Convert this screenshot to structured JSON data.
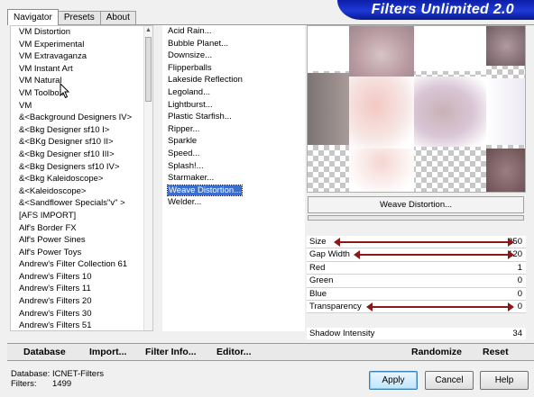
{
  "tabs": [
    "Navigator",
    "Presets",
    "About"
  ],
  "banner_title": "Filters Unlimited 2.0",
  "categories": [
    "VM Distortion",
    "VM Experimental",
    "VM Extravaganza",
    "VM Instant Art",
    "VM Natural",
    "VM Toolbox",
    "VM",
    "&<Background Designers IV>",
    "&<Bkg Designer sf10 I>",
    "&<BKg Designer sf10 II>",
    "&<Bkg Designer sf10 III>",
    "&<Bkg Designers sf10 IV>",
    "&<Bkg Kaleidoscope>",
    "&<Kaleidoscope>",
    "&<Sandflower Specials\"v\" >",
    "[AFS IMPORT]",
    "Alf's Border FX",
    "Alf's Power Sines",
    "Alf's Power Toys",
    "Andrew's Filter Collection 61",
    "Andrew's Filters 10",
    "Andrew's Filters 11",
    "Andrew's Filters 20",
    "Andrew's Filters 30",
    "Andrew's Filters 51"
  ],
  "filters": [
    "Acid Rain...",
    "Bubble Planet...",
    "Downsize...",
    "Flipperballs",
    "Lakeside Reflection",
    "Legoland...",
    "Lightburst...",
    "Plastic Starfish...",
    "Ripper...",
    "Sparkle",
    "Speed...",
    "Splash!...",
    "Starmaker...",
    "Weave Distortion...",
    "Welder..."
  ],
  "selected_filter": "Weave Distortion...",
  "filter_name_button": "Weave Distortion...",
  "params": [
    {
      "label": "Size",
      "value": "250"
    },
    {
      "label": "Gap Width",
      "value": "120"
    },
    {
      "label": "Red",
      "value": "1"
    },
    {
      "label": "Green",
      "value": "0"
    },
    {
      "label": "Blue",
      "value": "0"
    },
    {
      "label": "Transparency",
      "value": "0"
    }
  ],
  "shadow": {
    "label": "Shadow Intensity",
    "value": "34"
  },
  "links": {
    "database": "Database",
    "import": "Import...",
    "filter_info": "Filter Info...",
    "editor": "Editor...",
    "randomize": "Randomize",
    "reset": "Reset"
  },
  "footer": {
    "db_label": "Database:",
    "db_value": "ICNET-Filters",
    "filters_label": "Filters:",
    "filters_value": "1499"
  },
  "buttons": {
    "apply": "Apply",
    "cancel": "Cancel",
    "help": "Help"
  },
  "colors": {
    "banner": "#1e3ad6",
    "selection": "#3a6fd0",
    "arrow": "#8a1a1a"
  }
}
